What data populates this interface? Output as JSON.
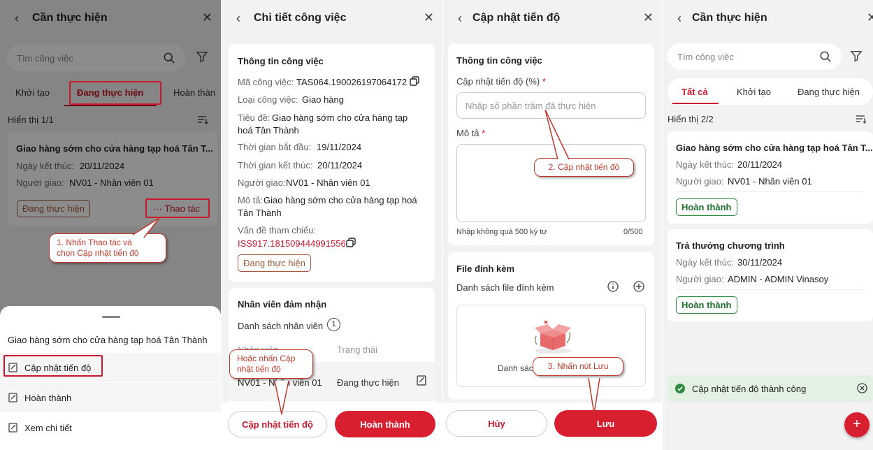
{
  "panel1": {
    "title": "Cần thực hiện",
    "search_placeholder": "Tìm công việc",
    "tabs": [
      "Khởi tạo",
      "Đang thực hiện",
      "Hoàn thàn"
    ],
    "count_label": "Hiển thị 1/1",
    "task": {
      "title": "Giao hàng sớm  cho cửa hàng tạp hoá Tân T...",
      "end_date_label": "Ngày kết thúc:",
      "end_date": "20/11/2024",
      "assigner_label": "Người giao:",
      "assigner": "NV01 - Nhân viên 01",
      "status": "Đang thực hiện",
      "action": "··· Thao tác"
    },
    "callout": "1. Nhấn Thao tác và\nchọn Cập nhật tiến độ",
    "sheet": {
      "title": "Giao hàng sớm  cho cửa hàng tạp hoá Tân Thành",
      "items": [
        "Cập nhật tiến độ",
        "Hoàn thành",
        "Xem chi tiết"
      ]
    }
  },
  "panel2": {
    "title": "Chi tiết công việc",
    "section_info": "Thông tin công việc",
    "code_label": "Mã công việc:",
    "code": "TAS064.190026197064172",
    "type_label": "Loại công việc:",
    "type": "Giao hàng",
    "subject_label": "Tiêu đề:",
    "subject_line1": "Giao hàng sớm  cho cửa hàng tạp",
    "subject_line2": "hoá Tân Thành",
    "start_label": "Thời gian bắt đầu:",
    "start": "19/11/2024",
    "end_label": "Thời gian kết thúc:",
    "end": "20/11/2024",
    "assigner_label": "Người giao:",
    "assigner": "NV01 - Nhân viên 01",
    "desc_label": "Mô tả:",
    "desc_line1": "Giao hàng sớm  cho cửa hàng tạp hoá",
    "desc_line2": "Tân Thành",
    "ref_label": "Vấn đề tham chiếu:",
    "ref": "ISS917.181509444991556",
    "status": "Đang thực hiện",
    "section_staff": "Nhân viên đảm nhận",
    "staff_list_label": "Danh sách nhân viên",
    "staff_count": "1",
    "col_staff": "Nhân viên",
    "col_status": "Trạng thái",
    "row_staff": "NV01 - Nhân viên 01",
    "row_status": "Đang thực hiện",
    "callout": "Hoặc nhấn Cập\nnhật tiến độ",
    "btn_update": "Cập nhật tiến độ",
    "btn_done": "Hoàn thành"
  },
  "panel3": {
    "title": "Cập nhật tiến độ",
    "section_info": "Thông tin công việc",
    "progress_label": "Cập nhật tiến độ (%)",
    "required_mark": "*",
    "progress_placeholder": "Nhập số phần trăm đã thực hiện",
    "desc_label": "Mô tả",
    "desc_hint": "Nhập không quá 500 ký tự",
    "desc_counter": "0/500",
    "attach_title": "File đính kèm",
    "attach_list_label": "Danh sách file đính kèm",
    "attach_empty": "Danh sác",
    "callout_progress": "2. Cập nhật tiến độ",
    "callout_save": "3. Nhấn nút Lưu",
    "btn_cancel": "Hủy",
    "btn_save": "Lưu"
  },
  "panel4": {
    "title": "Cần thực hiện",
    "search_placeholder": "Tìm công việc",
    "tabs": [
      "Tất cả",
      "Khởi tạo",
      "Đang thực hiện"
    ],
    "count_label": "Hiển thị 2/2",
    "tasks": [
      {
        "title": "Giao hàng sớm  cho cửa hàng tạp hoá Tân T...",
        "end_date_label": "Ngày kết thúc:",
        "end_date": "20/11/2024",
        "assigner_label": "Người giao:",
        "assigner": "NV01 - Nhân viên 01",
        "status": "Hoàn thành"
      },
      {
        "title": "Trả thưởng chương trình",
        "end_date_label": "Ngày kết thúc:",
        "end_date": "30/11/2024",
        "assigner_label": "Người giao:",
        "assigner": "ADMIN - ADMIN Vinasoy",
        "status": "Hoàn thành"
      }
    ],
    "toast": "Cập nhật tiến độ thành công",
    "fab": "+"
  },
  "colors": {
    "accent_red": "#d71f30",
    "status_brown": "#a35a3a",
    "success_green": "#2e8b3f",
    "callout_red": "#c0392b"
  }
}
